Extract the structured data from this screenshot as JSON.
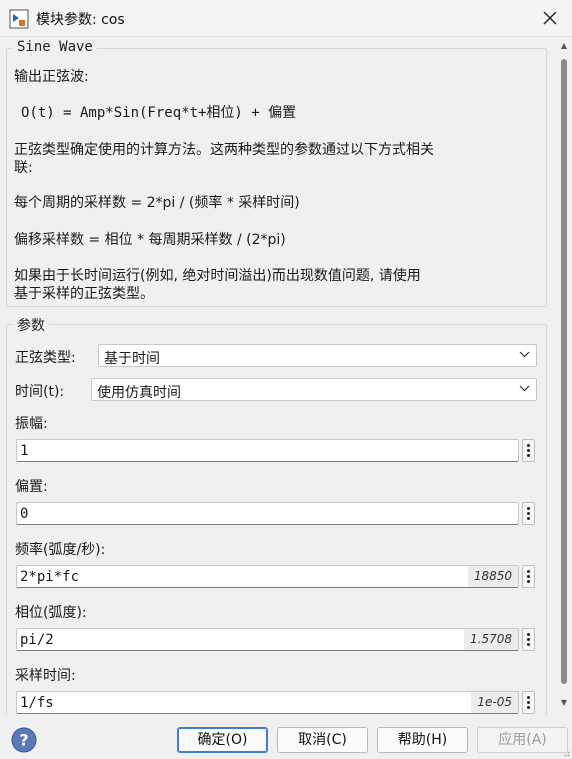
{
  "window": {
    "title": "模块参数: cos"
  },
  "description_group": {
    "title": "Sine Wave",
    "lines": [
      "输出正弦波:",
      "O(t) = Amp*Sin(Freq*t+相位) + 偏置",
      "正弦类型确定使用的计算方法。这两种类型的参数通过以下方式相关",
      "联:",
      "每个周期的采样数 = 2*pi / (频率 * 采样时间)",
      "偏移采样数 = 相位 * 每周期采样数 / (2*pi)",
      "如果由于长时间运行(例如, 绝对时间溢出)而出现数值问题, 请使用",
      "基于采样的正弦类型。"
    ]
  },
  "params_group": {
    "title": "参数",
    "sine_type": {
      "label": "正弦类型:",
      "value": "基于时间"
    },
    "time": {
      "label": "时间(t):",
      "value": "使用仿真时间"
    },
    "amplitude": {
      "label": "振幅:",
      "value": "1"
    },
    "bias": {
      "label": "偏置:",
      "value": "0"
    },
    "frequency": {
      "label": "频率(弧度/秒):",
      "value": "2*pi*fc",
      "evaluated": "18850"
    },
    "phase": {
      "label": "相位(弧度):",
      "value": "pi/2",
      "evaluated": "1.5708"
    },
    "sample_time": {
      "label": "采样时间:",
      "value": "1/fs",
      "evaluated": "1e-05"
    }
  },
  "footer": {
    "ok_label": "确定(O)",
    "cancel_label": "取消(C)",
    "help_label": "帮助(H)",
    "apply_label": "应用(A)"
  },
  "colors": {
    "accent": "#3c7fd1",
    "help_icon": "#5b79b8",
    "background": "#f0f0f0"
  }
}
